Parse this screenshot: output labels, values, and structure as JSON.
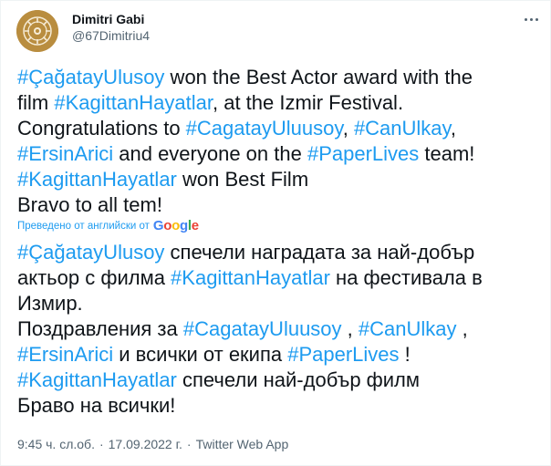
{
  "user": {
    "name": "Dimitri Gabi",
    "handle": "@67Dimitriu4"
  },
  "tweet": {
    "original_lines": [
      [
        {
          "t": "#ÇağatayUlusoy",
          "tag": true
        },
        {
          "t": " won the Best Actor award with the",
          "tag": false
        }
      ],
      [
        {
          "t": "film ",
          "tag": false
        },
        {
          "t": "#KagittanHayatlar",
          "tag": true
        },
        {
          "t": ", at the Izmir Festival.",
          "tag": false
        }
      ],
      [
        {
          "t": "Congratulations to ",
          "tag": false
        },
        {
          "t": "#CagatayUluusoy",
          "tag": true
        },
        {
          "t": ", ",
          "tag": false
        },
        {
          "t": "#CanUlkay",
          "tag": true
        },
        {
          "t": ",",
          "tag": false
        }
      ],
      [
        {
          "t": "#ErsinArici",
          "tag": true
        },
        {
          "t": " and everyone on the ",
          "tag": false
        },
        {
          "t": "#PaperLives",
          "tag": true
        },
        {
          "t": " team!",
          "tag": false
        }
      ],
      [
        {
          "t": "#KagittanHayatlar",
          "tag": true
        },
        {
          "t": " won Best Film",
          "tag": false
        }
      ],
      [
        {
          "t": "Bravo to all tem!",
          "tag": false
        }
      ]
    ],
    "translated_note": "Преведено от английски от",
    "translated_lines": [
      [
        {
          "t": "#ÇağatayUlusoy",
          "tag": true
        },
        {
          "t": " спечели наградата за най-добър",
          "tag": false
        }
      ],
      [
        {
          "t": "актьор с филма ",
          "tag": false
        },
        {
          "t": "#KagittanHayatlar",
          "tag": true
        },
        {
          "t": " на фестивала в",
          "tag": false
        }
      ],
      [
        {
          "t": "Измир.",
          "tag": false
        }
      ],
      [
        {
          "t": "Поздравления за ",
          "tag": false
        },
        {
          "t": "#CagatayUluusoy",
          "tag": true
        },
        {
          "t": " , ",
          "tag": false
        },
        {
          "t": "#CanUlkay",
          "tag": true
        },
        {
          "t": " ,",
          "tag": false
        }
      ],
      [
        {
          "t": "#ErsinArici",
          "tag": true
        },
        {
          "t": " и всички от екипа ",
          "tag": false
        },
        {
          "t": "#PaperLives",
          "tag": true
        },
        {
          "t": " !",
          "tag": false
        }
      ],
      [
        {
          "t": "#KagittanHayatlar",
          "tag": true
        },
        {
          "t": " спечели най-добър филм",
          "tag": false
        }
      ],
      [
        {
          "t": "Браво на всички!",
          "tag": false
        }
      ]
    ]
  },
  "meta": {
    "time": "9:45 ч. сл.об.",
    "separator": "·",
    "date": "17.09.2022 г.",
    "source": "Twitter Web App"
  },
  "icons": {
    "avatar": "ornament-emblem-icon",
    "more": "more-horizontal-icon",
    "google": "google-logo"
  },
  "colors": {
    "link": "#1d9bf0",
    "text": "#0f1419",
    "secondary": "#536471",
    "avatar_bg": "#b58a3d"
  }
}
